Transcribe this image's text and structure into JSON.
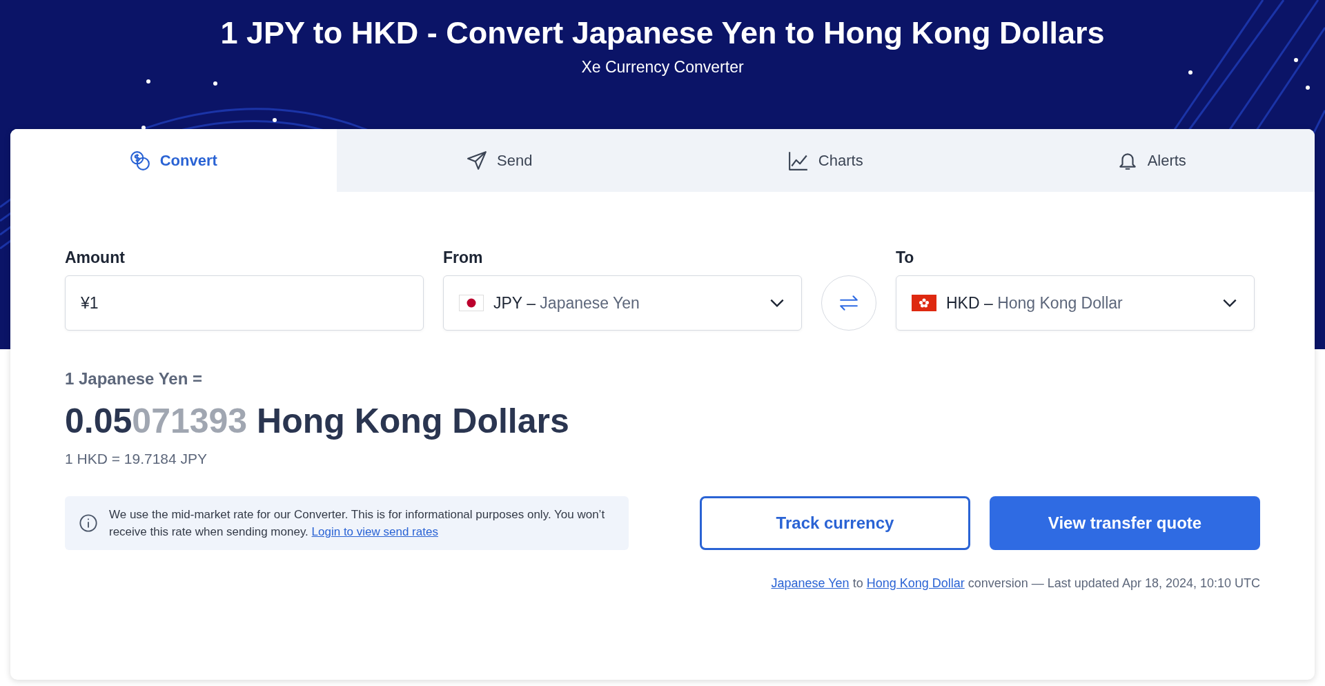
{
  "header": {
    "title": "1 JPY to HKD - Convert Japanese Yen to Hong Kong Dollars",
    "subtitle": "Xe Currency Converter"
  },
  "tabs": [
    {
      "label": "Convert",
      "selected": true
    },
    {
      "label": "Send",
      "selected": false
    },
    {
      "label": "Charts",
      "selected": false
    },
    {
      "label": "Alerts",
      "selected": false
    }
  ],
  "amount": {
    "label": "Amount",
    "value": "¥1"
  },
  "from": {
    "label": "From",
    "code": "JPY",
    "separator": "–",
    "name": "Japanese Yen"
  },
  "to": {
    "label": "To",
    "code": "HKD",
    "separator": "–",
    "name": "Hong Kong Dollar"
  },
  "result": {
    "from_line": "1 Japanese Yen =",
    "value_main": "0.05",
    "value_faded": "071393",
    "unit": "Hong Kong Dollars",
    "inverse": "1 HKD = 19.7184 JPY"
  },
  "notice": {
    "text": "We use the mid-market rate for our Converter. This is for informational purposes only. You won’t receive this rate when sending money.",
    "link": "Login to view send rates"
  },
  "buttons": [
    {
      "label": "Track currency",
      "kind": "outline"
    },
    {
      "label": "View transfer quote",
      "kind": "primary"
    }
  ],
  "footer": {
    "from_link": "Japanese Yen",
    "joiner": "to",
    "to_link": "Hong Kong Dollar",
    "text": "conversion — Last updated Apr 18, 2024, 10:10 UTC"
  }
}
